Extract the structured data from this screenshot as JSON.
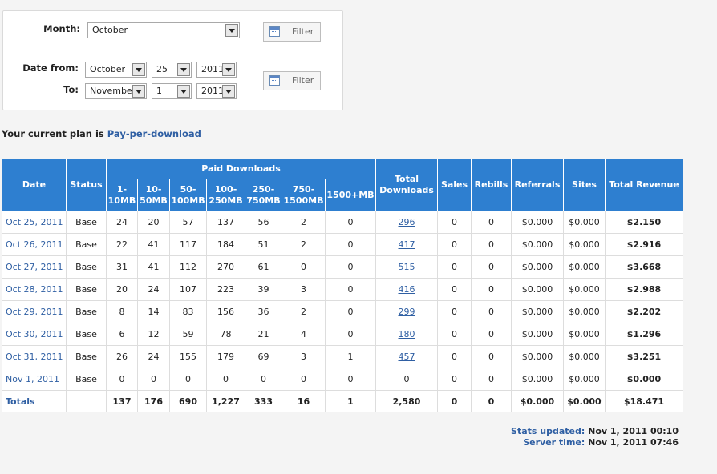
{
  "filter": {
    "month_label": "Month:",
    "month_value": "October",
    "filter_label": "Filter",
    "date_from_label": "Date from:",
    "to_label": "To:",
    "from": {
      "month": "October",
      "day": "25",
      "year": "2011"
    },
    "to": {
      "month": "November",
      "day": "1",
      "year": "2011"
    }
  },
  "plan": {
    "prefix": "Your current plan is",
    "name": "Pay-per-download"
  },
  "table": {
    "headers": {
      "date": "Date",
      "status": "Status",
      "paid": "Paid Downloads",
      "sizes": [
        "1-\n10MB",
        "10-\n50MB",
        "50-\n100MB",
        "100-\n250MB",
        "250-\n750MB",
        "750-\n1500MB",
        "1500+MB"
      ],
      "total_downloads": "Total\nDownloads",
      "sales": "Sales",
      "rebills": "Rebills",
      "referrals": "Referrals",
      "sites": "Sites",
      "total_revenue": "Total Revenue"
    },
    "rows": [
      {
        "date": "Oct 25, 2011",
        "status": "Base",
        "sizes": [
          "24",
          "20",
          "57",
          "137",
          "56",
          "2",
          "0"
        ],
        "total": "296",
        "sales": "0",
        "rebills": "0",
        "referrals": "$0.000",
        "sites": "$0.000",
        "revenue": "$2.150"
      },
      {
        "date": "Oct 26, 2011",
        "status": "Base",
        "sizes": [
          "22",
          "41",
          "117",
          "184",
          "51",
          "2",
          "0"
        ],
        "total": "417",
        "sales": "0",
        "rebills": "0",
        "referrals": "$0.000",
        "sites": "$0.000",
        "revenue": "$2.916"
      },
      {
        "date": "Oct 27, 2011",
        "status": "Base",
        "sizes": [
          "31",
          "41",
          "112",
          "270",
          "61",
          "0",
          "0"
        ],
        "total": "515",
        "sales": "0",
        "rebills": "0",
        "referrals": "$0.000",
        "sites": "$0.000",
        "revenue": "$3.668"
      },
      {
        "date": "Oct 28, 2011",
        "status": "Base",
        "sizes": [
          "20",
          "24",
          "107",
          "223",
          "39",
          "3",
          "0"
        ],
        "total": "416",
        "sales": "0",
        "rebills": "0",
        "referrals": "$0.000",
        "sites": "$0.000",
        "revenue": "$2.988"
      },
      {
        "date": "Oct 29, 2011",
        "status": "Base",
        "sizes": [
          "8",
          "14",
          "83",
          "156",
          "36",
          "2",
          "0"
        ],
        "total": "299",
        "sales": "0",
        "rebills": "0",
        "referrals": "$0.000",
        "sites": "$0.000",
        "revenue": "$2.202"
      },
      {
        "date": "Oct 30, 2011",
        "status": "Base",
        "sizes": [
          "6",
          "12",
          "59",
          "78",
          "21",
          "4",
          "0"
        ],
        "total": "180",
        "sales": "0",
        "rebills": "0",
        "referrals": "$0.000",
        "sites": "$0.000",
        "revenue": "$1.296"
      },
      {
        "date": "Oct 31, 2011",
        "status": "Base",
        "sizes": [
          "26",
          "24",
          "155",
          "179",
          "69",
          "3",
          "1"
        ],
        "total": "457",
        "sales": "0",
        "rebills": "0",
        "referrals": "$0.000",
        "sites": "$0.000",
        "revenue": "$3.251"
      },
      {
        "date": "Nov 1, 2011",
        "status": "Base",
        "sizes": [
          "0",
          "0",
          "0",
          "0",
          "0",
          "0",
          "0"
        ],
        "total": "0",
        "sales": "0",
        "rebills": "0",
        "referrals": "$0.000",
        "sites": "$0.000",
        "revenue": "$0.000"
      }
    ],
    "totals": {
      "label": "Totals",
      "status": "",
      "sizes": [
        "137",
        "176",
        "690",
        "1,227",
        "333",
        "16",
        "1"
      ],
      "total": "2,580",
      "sales": "0",
      "rebills": "0",
      "referrals": "$0.000",
      "sites": "$0.000",
      "revenue": "$18.471"
    }
  },
  "footer": {
    "stats_updated_label": "Stats updated:",
    "stats_updated_value": "Nov 1, 2011 00:10",
    "server_time_label": "Server time:",
    "server_time_value": "Nov 1, 2011 07:46"
  },
  "colors": {
    "header_bg": "#2e7fd0",
    "link": "#2f5fa3"
  },
  "icons": {
    "filter_button": "calendar-icon",
    "dropdown": "chevron-down-icon"
  }
}
